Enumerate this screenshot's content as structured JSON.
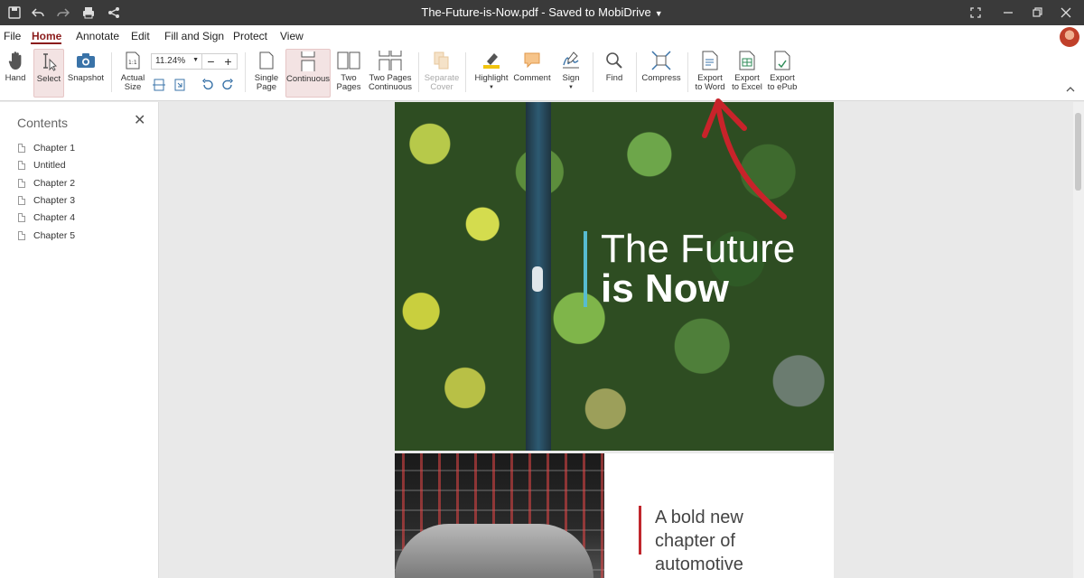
{
  "window": {
    "title": "The-Future-is-Now.pdf - Saved to MobiDrive"
  },
  "menu": {
    "items": [
      "File",
      "Home",
      "Annotate",
      "Edit",
      "Fill and Sign",
      "Protect",
      "View"
    ],
    "active": "Home"
  },
  "ribbon": {
    "hand": "Hand",
    "select": "Select",
    "snapshot": "Snapshot",
    "actual_size": "Actual\nSize",
    "zoom_value": "11.24%",
    "zoom_minus": "−",
    "zoom_plus": "+",
    "single_page": "Single\nPage",
    "continuous": "Continuous",
    "two_pages": "Two\nPages",
    "two_pages_continuous": "Two Pages\nContinuous",
    "separate_cover": "Separate\nCover",
    "highlight": "Highlight",
    "comment": "Comment",
    "sign": "Sign",
    "find": "Find",
    "compress": "Compress",
    "export_word": "Export\nto Word",
    "export_excel": "Export\nto Excel",
    "export_epub": "Export\nto ePub"
  },
  "sidebar": {
    "title": "Contents",
    "items": [
      "Chapter 1",
      "Untitled",
      "Chapter 2",
      "Chapter 3",
      "Chapter 4",
      "Chapter 5"
    ]
  },
  "document": {
    "cover_line1": "The Future",
    "cover_line2": "is Now",
    "page2_text": "A bold new\nchapter of\nautomotive"
  },
  "colors": {
    "accent": "#8b1c1c",
    "arrow": "#c8232a",
    "cover_bar": "#57bcd1",
    "page2_bar": "#c0262c"
  }
}
